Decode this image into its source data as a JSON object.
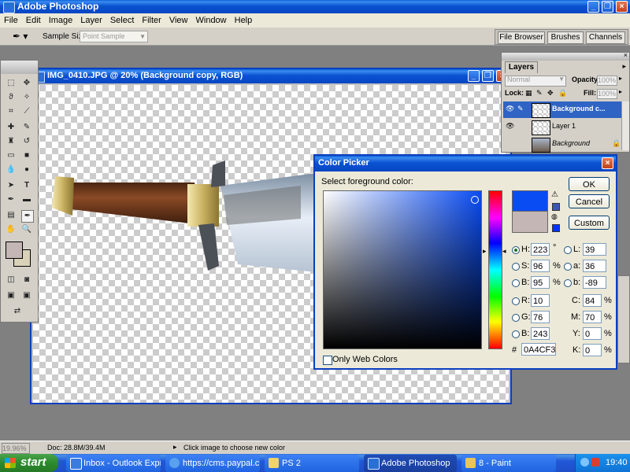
{
  "app": {
    "title": "Adobe Photoshop",
    "menus": [
      "File",
      "Edit",
      "Image",
      "Layer",
      "Select",
      "Filter",
      "View",
      "Window",
      "Help"
    ]
  },
  "options_bar": {
    "sample_size_label": "Sample Size:",
    "sample_size_value": "Point Sample",
    "palette_tabs": [
      "File Browser",
      "Brushes",
      "Channels"
    ]
  },
  "document": {
    "title": "IMG_0410.JPG @ 20% (Background copy, RGB)",
    "zoom": "19.96%",
    "doc_info": "Doc: 28.8M/39.4M",
    "status_hint": "Click image to choose new color"
  },
  "layers": {
    "tab": "Layers",
    "blend_mode": "Normal",
    "opacity_label": "Opacity:",
    "opacity_value": "100%",
    "lock_label": "Lock:",
    "fill_label": "Fill:",
    "fill_value": "100%",
    "items": [
      {
        "name": "Background c...",
        "selected": true
      },
      {
        "name": "Layer 1",
        "selected": false
      },
      {
        "name": "Background",
        "selected": false,
        "italic": true
      }
    ]
  },
  "color_picker": {
    "title": "Color Picker",
    "prompt": "Select foreground color:",
    "buttons": {
      "ok": "OK",
      "cancel": "Cancel",
      "custom": "Custom"
    },
    "new_color": "#0A4CF3",
    "old_color": "#c3b6b4",
    "hsb": {
      "H_label": "H:",
      "H": "223",
      "H_unit": "°",
      "S_label": "S:",
      "S": "96",
      "S_unit": "%",
      "B_label": "B:",
      "B": "95",
      "B_unit": "%"
    },
    "rgb": {
      "R_label": "R:",
      "R": "10",
      "G_label": "G:",
      "G": "76",
      "B_label": "B:",
      "B": "243"
    },
    "lab": {
      "L_label": "L:",
      "L": "39",
      "a_label": "a:",
      "a": "36",
      "b_label": "b:",
      "b": "-89"
    },
    "cmyk": {
      "C_label": "C:",
      "C": "84",
      "C_unit": "%",
      "M_label": "M:",
      "M": "70",
      "M_unit": "%",
      "Y_label": "Y:",
      "Y": "0",
      "Y_unit": "%",
      "K_label": "K:",
      "K": "0",
      "K_unit": "%"
    },
    "hex_label": "#",
    "hex": "0A4CF3",
    "web_only_label": "Only Web Colors"
  },
  "taskbar": {
    "start": "start",
    "tasks": [
      "Inbox - Outlook Express",
      "https://cms.paypal.c...",
      "PS 2",
      "Adobe Photoshop",
      "8 - Paint"
    ],
    "time": "19:40"
  }
}
